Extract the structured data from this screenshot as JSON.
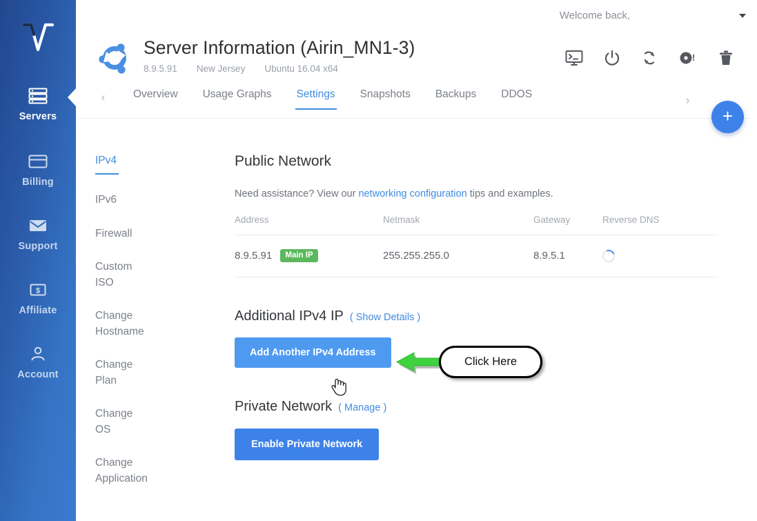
{
  "sidebar": {
    "logo": "vultr-v-logo",
    "items": [
      {
        "label": "Servers",
        "icon": "server-stack-icon",
        "active": true
      },
      {
        "label": "Billing",
        "icon": "credit-card-icon",
        "active": false
      },
      {
        "label": "Support",
        "icon": "envelope-icon",
        "active": false
      },
      {
        "label": "Affiliate",
        "icon": "dollar-box-icon",
        "active": false
      },
      {
        "label": "Account",
        "icon": "person-icon",
        "active": false
      }
    ]
  },
  "topbar": {
    "welcome": "Welcome back,",
    "caret": "chevron-down-icon"
  },
  "header": {
    "os_logo": "ubuntu-logo",
    "title": "Server Information (Airin_MN1-3)",
    "meta": {
      "ip": "8.9.5.91",
      "location": "New Jersey",
      "os": "Ubuntu 16.04 x64"
    },
    "actions": [
      {
        "name": "console-icon",
        "title": "Console"
      },
      {
        "name": "power-icon",
        "title": "Power"
      },
      {
        "name": "restart-icon",
        "title": "Restart"
      },
      {
        "name": "reinstall-icon",
        "title": "Reinstall"
      },
      {
        "name": "trash-icon",
        "title": "Destroy"
      }
    ]
  },
  "tabs": {
    "prev": "‹",
    "next": "›",
    "items": [
      {
        "label": "Overview",
        "active": false
      },
      {
        "label": "Usage Graphs",
        "active": false
      },
      {
        "label": "Settings",
        "active": true
      },
      {
        "label": "Snapshots",
        "active": false
      },
      {
        "label": "Backups",
        "active": false
      },
      {
        "label": "DDOS",
        "active": false
      }
    ]
  },
  "fab": {
    "label": "+"
  },
  "settings_menu": {
    "items": [
      {
        "label": "IPv4",
        "active": true
      },
      {
        "label": "IPv6",
        "active": false
      },
      {
        "label": "Firewall",
        "active": false
      },
      {
        "label": "Custom ISO",
        "active": false
      },
      {
        "label": "Change Hostname",
        "active": false
      },
      {
        "label": "Change Plan",
        "active": false
      },
      {
        "label": "Change OS",
        "active": false
      },
      {
        "label": "Change Application",
        "active": false
      }
    ]
  },
  "public_network": {
    "title": "Public Network",
    "assist_prefix": "Need assistance? View our ",
    "assist_link": "networking configuration",
    "assist_suffix": " tips and examples.",
    "columns": [
      "Address",
      "Netmask",
      "Gateway",
      "Reverse DNS"
    ],
    "rows": [
      {
        "address": "8.9.5.91",
        "badge": "Main IP",
        "netmask": "255.255.255.0",
        "gateway": "8.9.5.1",
        "reverse_dns": "loading-spinner"
      }
    ]
  },
  "additional_ipv4": {
    "title": "Additional IPv4 IP",
    "link": "( Show Details )",
    "button": "Add Another IPv4 Address"
  },
  "private_network": {
    "title": "Private Network",
    "link": "( Manage )",
    "button": "Enable Private Network"
  },
  "annotation": {
    "callout_text": "Click Here",
    "arrow": "green-left-arrow",
    "cursor": "pointing-hand-cursor"
  },
  "colors": {
    "accent_blue": "#3f8ce0",
    "button_light_blue": "#4e9af1",
    "button_blue": "#3d82e8",
    "sidebar_dark": "#22478f",
    "sidebar_light": "#3b7ad0",
    "badge_green": "#5cb85c",
    "arrow_green": "#3fd23f",
    "text_dark": "#33363a",
    "text_muted": "#7b8089"
  }
}
